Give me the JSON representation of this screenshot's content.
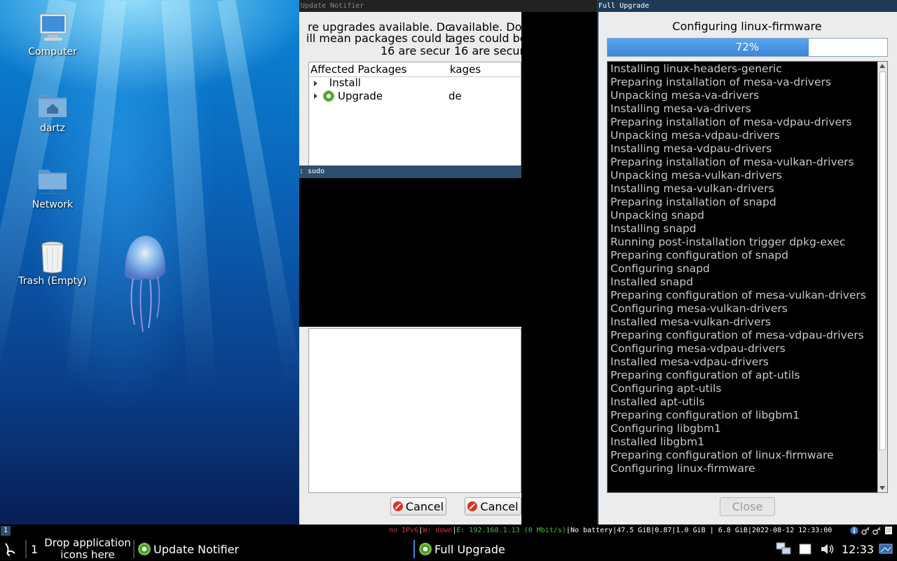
{
  "desktop": {
    "icons": [
      {
        "label": "Computer"
      },
      {
        "label": "dartz"
      },
      {
        "label": "Network"
      },
      {
        "label": "Trash (Empty)"
      }
    ]
  },
  "update_notifier": {
    "title": "Update Notifier",
    "line1_a": "re upgrades available. Do",
    "line1_b": "available. Do",
    "line2_a": "ill mean packages could be",
    "line2_b": "ages could be",
    "line3_a": "16 are securi",
    "line3_b": "16 are secur",
    "affected_header": "Affected Packages",
    "affected_header_dup": "kages",
    "tree": {
      "install": "Install",
      "upgrade": "Upgrade",
      "upgrade_dup": "de"
    },
    "sudo_label": ": sudo",
    "cancel_label": "Cancel"
  },
  "full_upgrade": {
    "title": "Full Upgrade",
    "heading": "Configuring linux-firmware",
    "progress_percent": 72,
    "progress_label": "72%",
    "log": [
      "Installing linux-headers-generic",
      "Preparing installation of mesa-va-drivers",
      "Unpacking mesa-va-drivers",
      "Installing mesa-va-drivers",
      "Preparing installation of mesa-vdpau-drivers",
      "Unpacking mesa-vdpau-drivers",
      "Installing mesa-vdpau-drivers",
      "Preparing installation of mesa-vulkan-drivers",
      "Unpacking mesa-vulkan-drivers",
      "Installing mesa-vulkan-drivers",
      "Preparing installation of snapd",
      "Unpacking snapd",
      "Installing snapd",
      "Running post-installation trigger dpkg-exec",
      "Preparing configuration of snapd",
      "Configuring snapd",
      "Installed snapd",
      "Preparing configuration of mesa-vulkan-drivers",
      "Configuring mesa-vulkan-drivers",
      "Installed mesa-vulkan-drivers",
      "Preparing configuration of mesa-vdpau-drivers",
      "Configuring mesa-vdpau-drivers",
      "Installed mesa-vdpau-drivers",
      "Preparing configuration of apt-utils",
      "Configuring apt-utils",
      "Installed apt-utils",
      "Preparing configuration of libgbm1",
      "Configuring libgbm1",
      "Installed libgbm1",
      "Preparing configuration of linux-firmware",
      "Configuring linux-firmware"
    ],
    "close_label": "Close"
  },
  "statusbar": {
    "workspace": "1",
    "ipv6": "no IPv6",
    "wifi": "W: down",
    "ethernet": "E: 192.168.1.13 (0 Mbit/s)",
    "battery": "No battery",
    "disk": "47.5 GiB",
    "load": "0.87",
    "mem_used": "1.0 GiB",
    "mem_free": "6.8 GiB",
    "datetime": "2022-08-12 12:33:00"
  },
  "taskbar": {
    "workspace_number": "1",
    "drop_hint_line1": "Drop application",
    "drop_hint_line2": "icons here",
    "task1": "Update Notifier",
    "task2": "Full Upgrade",
    "clock": "12:33"
  },
  "colors": {
    "progress_fill": "#3a86d8",
    "titlebar_active": "#1f3a57",
    "status_red": "#e03030",
    "status_green": "#3ec43e"
  }
}
